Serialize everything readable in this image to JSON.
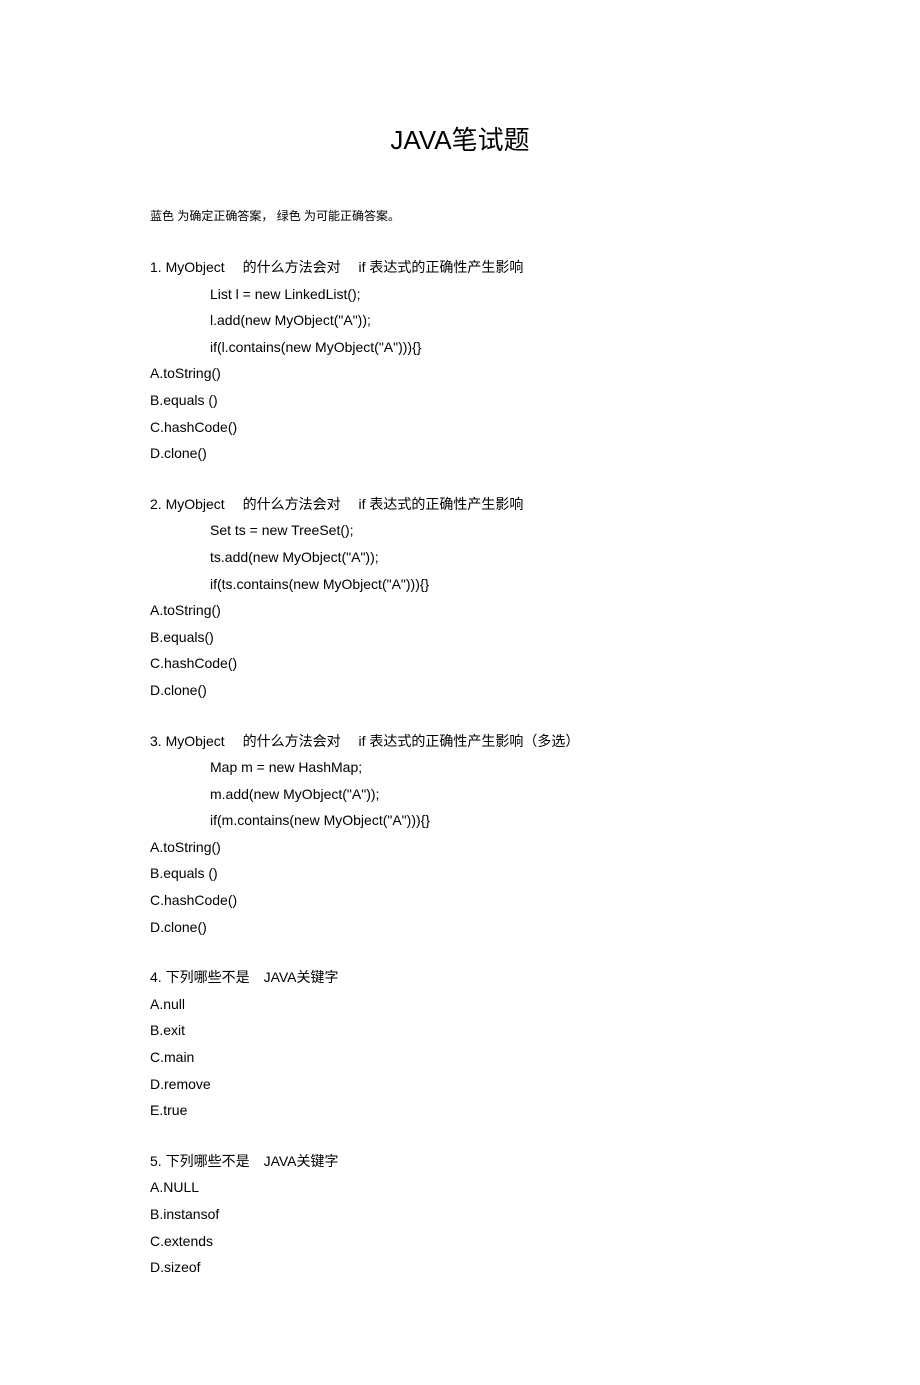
{
  "title": "JAVA笔试题",
  "note_prefix": "蓝色 为确定正确答案，",
  "note_suffix": "绿色 为可能正确答案。",
  "q1": {
    "head": "1. MyObject　 的什么方法会对　 if  表达式的正确性产生影响",
    "code1": "List l = new LinkedList();",
    "code2": "l.add(new MyObject(\"A\"));",
    "code3": "if(l.contains(new MyObject(\"A\"))){}",
    "a": "A.toString()",
    "b": "B.equals ()",
    "c": "C.hashCode()",
    "d": "D.clone()"
  },
  "q2": {
    "head": "2. MyObject　 的什么方法会对　 if  表达式的正确性产生影响",
    "code1": "Set ts = new TreeSet();",
    "code2": "ts.add(new MyObject(\"A\"));",
    "code3": "if(ts.contains(new MyObject(\"A\"))){}",
    "a": "A.toString()",
    "b": "B.equals()",
    "c": "C.hashCode()",
    "d": "D.clone()"
  },
  "q3": {
    "head": "3. MyObject　 的什么方法会对　 if  表达式的正确性产生影响（多选）",
    "code1": "Map m = new HashMap;",
    "code2": "m.add(new MyObject(\"A\"));",
    "code3": "if(m.contains(new MyObject(\"A\"))){}",
    "a": "A.toString()",
    "b": "B.equals ()",
    "c": "C.hashCode()",
    "d": "D.clone()"
  },
  "q4": {
    "head": "4. 下列哪些不是　JAVA关键字",
    "a": "A.null",
    "b": "B.exit",
    "c": "C.main",
    "d": "D.remove",
    "e": "E.true"
  },
  "q5": {
    "head": "5. 下列哪些不是　JAVA关键字",
    "a": "A.NULL",
    "b": "B.instansof",
    "c": "C.extends",
    "d": "D.sizeof"
  }
}
